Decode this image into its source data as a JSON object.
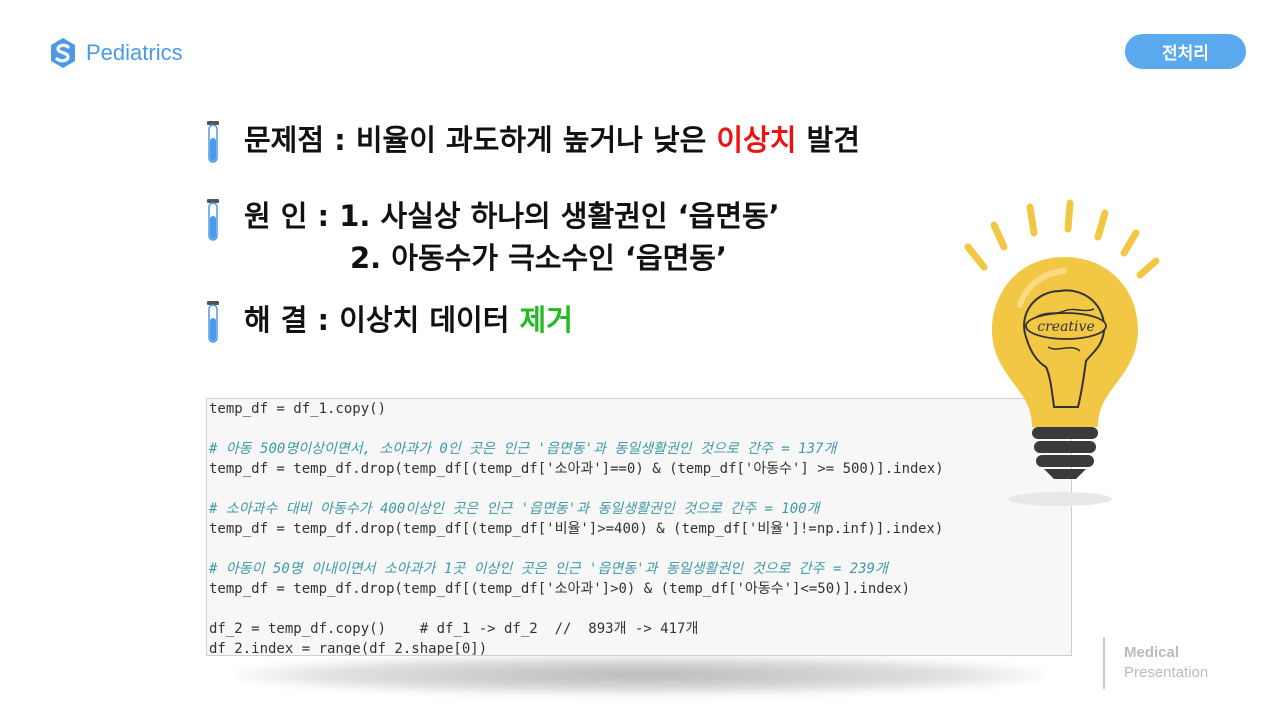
{
  "header": {
    "logo_text": "Pediatrics",
    "section_tag": "전처리"
  },
  "bullets": {
    "problem": {
      "prefix": "문제점 : 비율이 과도하게 높거나 낮은 ",
      "highlight": "이상치",
      "suffix": " 발견"
    },
    "cause": {
      "line1": "원 인 : 1. 사실상 하나의 생활권인 ‘읍면동’",
      "line2": "2. 아동수가 극소수인 ‘읍면동’"
    },
    "solution": {
      "prefix": "해 결 : 이상치 데이터 ",
      "highlight": "제거"
    }
  },
  "illustration": {
    "bulb_word": "creative"
  },
  "code": {
    "lines": [
      "temp_df = df_1.copy()",
      "",
      "# 아동 500명이상이면서, 소아과가 0인 곳은 인근 '읍면동'과 동일생활권인 것으로 간주 = 137개",
      "temp_df = temp_df.drop(temp_df[(temp_df['소아과']==0) & (temp_df['아동수'] >= 500)].index)",
      "",
      "# 소아과수 대비 아동수가 400이상인 곳은 인근 '읍면동'과 동일생활권인 것으로 간주 = 100개",
      "temp_df = temp_df.drop(temp_df[(temp_df['비율']>=400) & (temp_df['비율']!=np.inf)].index)",
      "",
      "# 아동이 50명 이내이면서 소아과가 1곳 이상인 곳은 인근 '읍면동'과 동일생활권인 것으로 간주 = 239개",
      "temp_df = temp_df.drop(temp_df[(temp_df['소아과']>0) & (temp_df['아동수']<=50)].index)",
      "",
      "df_2 = temp_df.copy()    # df_1 -> df_2  //  893개 -> 417개",
      "df_2.index = range(df_2.shape[0])"
    ]
  },
  "footer": {
    "line1": "Medical",
    "line2": "Presentation"
  },
  "colors": {
    "accent": "#5aa8ee",
    "highlight_red": "#ee1111",
    "highlight_green": "#22bb22",
    "bulb": "#f2c744"
  }
}
